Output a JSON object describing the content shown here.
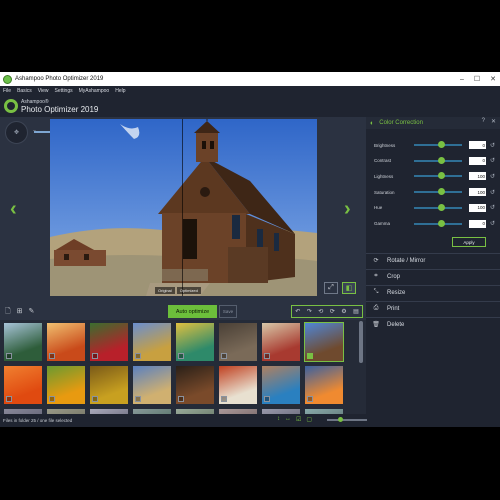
{
  "window": {
    "title": "Ashampoo Photo Optimizer 2019",
    "buttons": [
      "–",
      "☐",
      "✕"
    ]
  },
  "menu": [
    "File",
    "Basics",
    "View",
    "Settings",
    "MyAshampoo",
    "Help"
  ],
  "logo": {
    "brand": "Ashampoo®",
    "product": "Photo Optimizer 2019"
  },
  "viewer": {
    "prev_arrow": "‹",
    "next_arrow": "›",
    "label_original": "Original",
    "label_optimized": "Optimized",
    "zoom_level": 0.9
  },
  "panel": {
    "title": "Color Correction",
    "help_icon": "?",
    "close_icon": "✕",
    "controls": [
      {
        "label": "Brightness",
        "value": "0",
        "level": 0.58
      },
      {
        "label": "Contrast",
        "value": "0",
        "level": 0.58
      },
      {
        "label": "Lightness",
        "value": "100",
        "level": 0.58
      },
      {
        "label": "Saturation",
        "value": "100",
        "level": 0.58
      },
      {
        "label": "Hue",
        "value": "100",
        "level": 0.58
      },
      {
        "label": "Gamma",
        "value": "0",
        "level": 0.58
      }
    ],
    "apply": "Apply",
    "tools": [
      {
        "label": "Rotate / Mirror",
        "icon": "⟳"
      },
      {
        "label": "Crop",
        "icon": "⌗"
      },
      {
        "label": "Resize",
        "icon": "⤡"
      },
      {
        "label": "Print",
        "icon": "⎙"
      },
      {
        "label": "Delete",
        "icon": "🗑"
      }
    ]
  },
  "thumb_toolbar": {
    "auto_optimize": "Auto optimize",
    "save": "Save"
  },
  "thumbnails": [
    {
      "c1": "#2e5d3a",
      "c2": "#a8c4d8"
    },
    {
      "c1": "#c94a1a",
      "c2": "#f0c070"
    },
    {
      "c1": "#b8202a",
      "c2": "#3a6e2e"
    },
    {
      "c1": "#c8a040",
      "c2": "#6a8ed0"
    },
    {
      "c1": "#2e8a6a",
      "c2": "#e0c040"
    },
    {
      "c1": "#7a6a58",
      "c2": "#4a4036"
    },
    {
      "c1": "#a83a30",
      "c2": "#d8c8a8"
    },
    {
      "c1": "#6f4a2e",
      "c2": "#4f86d6"
    },
    {
      "c1": "#e04a10",
      "c2": "#f08030"
    },
    {
      "c1": "#e89a10",
      "c2": "#6a9a30"
    },
    {
      "c1": "#c8a020",
      "c2": "#7a5a18"
    },
    {
      "c1": "#d0b070",
      "c2": "#5a80c0"
    },
    {
      "c1": "#7a4a2a",
      "c2": "#2a2018"
    },
    {
      "c1": "#e8e0d0",
      "c2": "#c04020"
    },
    {
      "c1": "#2a80c0",
      "c2": "#b08060"
    },
    {
      "c1": "#f08a30",
      "c2": "#3a60a0"
    },
    {
      "c1": "#556",
      "c2": "#889"
    },
    {
      "c1": "#665",
      "c2": "#998"
    },
    {
      "c1": "#556",
      "c2": "#aab"
    },
    {
      "c1": "#465",
      "c2": "#899"
    },
    {
      "c1": "#565",
      "c2": "#9a9"
    },
    {
      "c1": "#655",
      "c2": "#a99"
    },
    {
      "c1": "#556",
      "c2": "#99a"
    },
    {
      "c1": "#566",
      "c2": "#8aa"
    }
  ],
  "status": {
    "text": "Files in folder 25 / one file selected"
  }
}
